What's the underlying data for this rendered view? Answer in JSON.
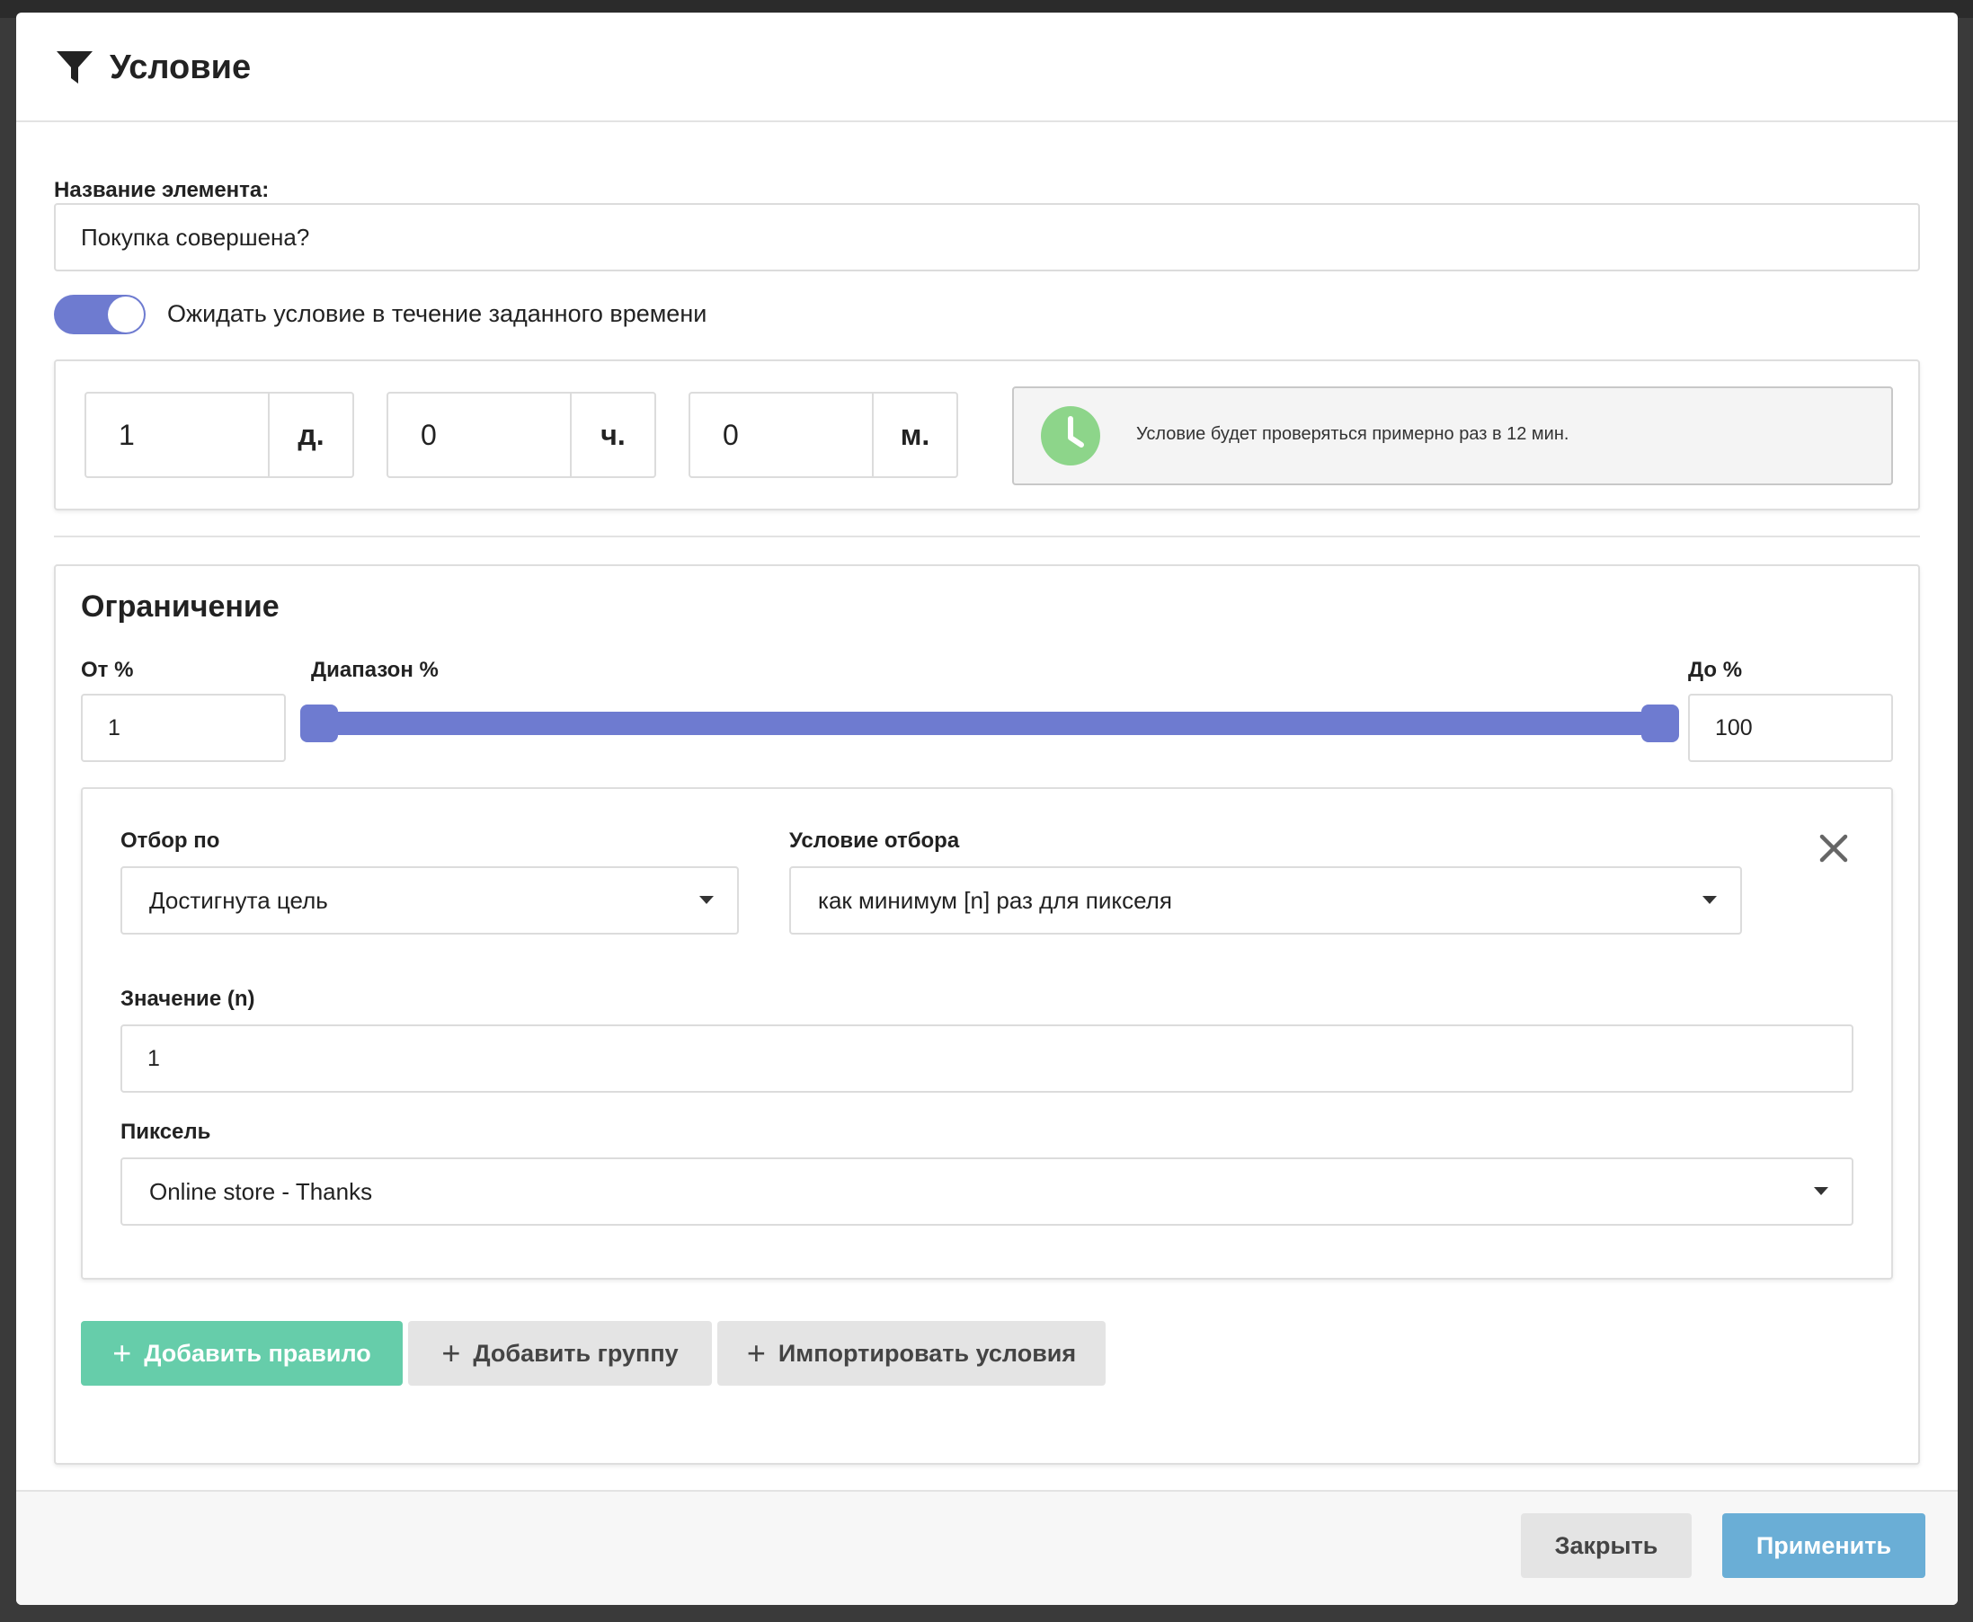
{
  "header": {
    "title": "Условие",
    "icon": "filter-icon"
  },
  "element_name": {
    "label": "Название элемента:",
    "value": "Покупка совершена?"
  },
  "wait_toggle": {
    "label": "Ожидать условие в течение заданного времени",
    "enabled": true
  },
  "duration": {
    "days": {
      "value": "1",
      "unit": "д."
    },
    "hours": {
      "value": "0",
      "unit": "ч."
    },
    "minutes": {
      "value": "0",
      "unit": "м."
    },
    "info": "Условие будет проверяться примерно раз в 12 мин.",
    "info_icon": "clock-icon"
  },
  "limit": {
    "title": "Ограничение",
    "from_label": "От %",
    "from_value": "1",
    "range_label": "Диапазон %",
    "to_label": "До %",
    "to_value": "100",
    "range_min": 1,
    "range_max": 100
  },
  "rule": {
    "filter_by_label": "Отбор по",
    "filter_by_value": "Достигнута цель",
    "condition_label": "Условие отбора",
    "condition_value": "как минимум [n] раз для пикселя",
    "value_label": "Значение (n)",
    "value": "1",
    "pixel_label": "Пиксель",
    "pixel_value": "Online store - Thanks"
  },
  "actions": {
    "add_rule": "Добавить правило",
    "add_group": "Добавить группу",
    "import_conditions": "Импортировать условия"
  },
  "footer": {
    "close": "Закрыть",
    "apply": "Применить"
  },
  "colors": {
    "accent": "#6e7bd0",
    "success": "#66cdaa",
    "primary": "#6aaed6",
    "clock": "#8dd58a"
  }
}
